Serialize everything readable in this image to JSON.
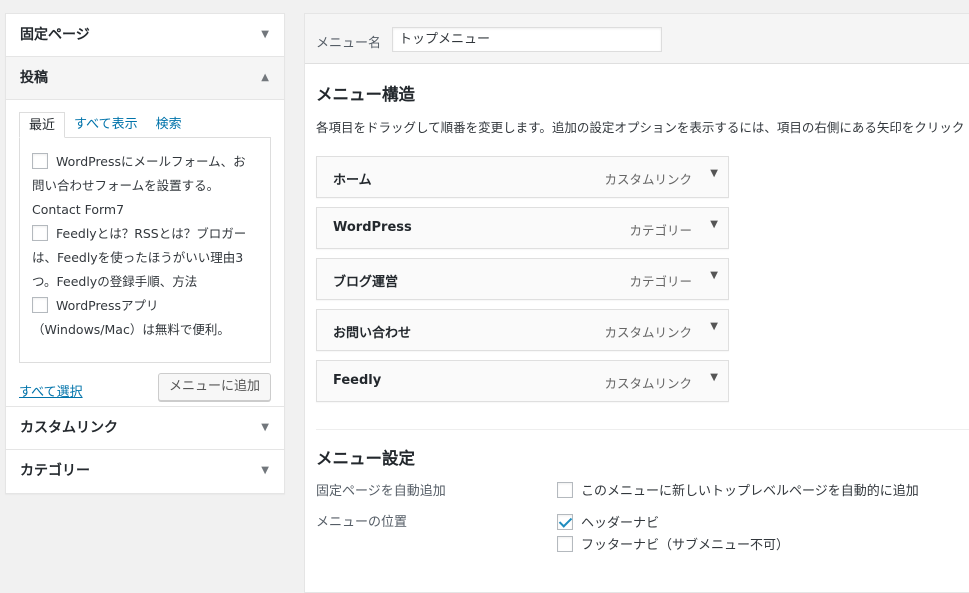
{
  "left": {
    "pages": {
      "title": "固定ページ"
    },
    "posts": {
      "title": "投稿",
      "tabs": [
        {
          "label": "最近"
        },
        {
          "label": "すべて表示"
        },
        {
          "label": "検索"
        }
      ],
      "items": [
        {
          "line1": "WordPressにメールフォーム、お",
          "line2": "問い合わせフォームを設置する。",
          "line3": "Contact Form7"
        },
        {
          "line1": "Feedlyとは？RSSとは？ブロガー",
          "line2": "は、Feedlyを使ったほうがいい理由3",
          "line3": "つ。Feedlyの登録手順、方法"
        },
        {
          "line1": "WordPressアプリ",
          "line2": "（Windows/Mac）は無料で便利。"
        }
      ],
      "select_all": "すべて選択",
      "add_button": "メニューに追加"
    },
    "custom_links": {
      "title": "カスタムリンク"
    },
    "categories": {
      "title": "カテゴリー"
    }
  },
  "right": {
    "menu_name_label": "メニュー名",
    "menu_name_value": "トップメニュー",
    "structure_title": "メニュー構造",
    "structure_desc": "各項目をドラッグして順番を変更します。追加の設定オプションを表示するには、項目の右側にある矢印をクリック",
    "menu_items": [
      {
        "title": "ホーム",
        "type": "カスタムリンク"
      },
      {
        "title": "WordPress",
        "type": "カテゴリー"
      },
      {
        "title": "ブログ運営",
        "type": "カテゴリー"
      },
      {
        "title": "お問い合わせ",
        "type": "カスタムリンク"
      },
      {
        "title": "Feedly",
        "type": "カスタムリンク"
      }
    ],
    "settings_title": "メニュー設定",
    "auto_add_label": "固定ページを自動追加",
    "auto_add_option": "このメニューに新しいトップレベルページを自動的に追加",
    "location_label": "メニューの位置",
    "locations": [
      {
        "label": "ヘッダーナビ",
        "checked": true
      },
      {
        "label": "フッターナビ（サブメニュー不可）",
        "checked": false
      }
    ]
  },
  "colors": {
    "link": "#0073aa",
    "check": "#1e8cbe"
  }
}
